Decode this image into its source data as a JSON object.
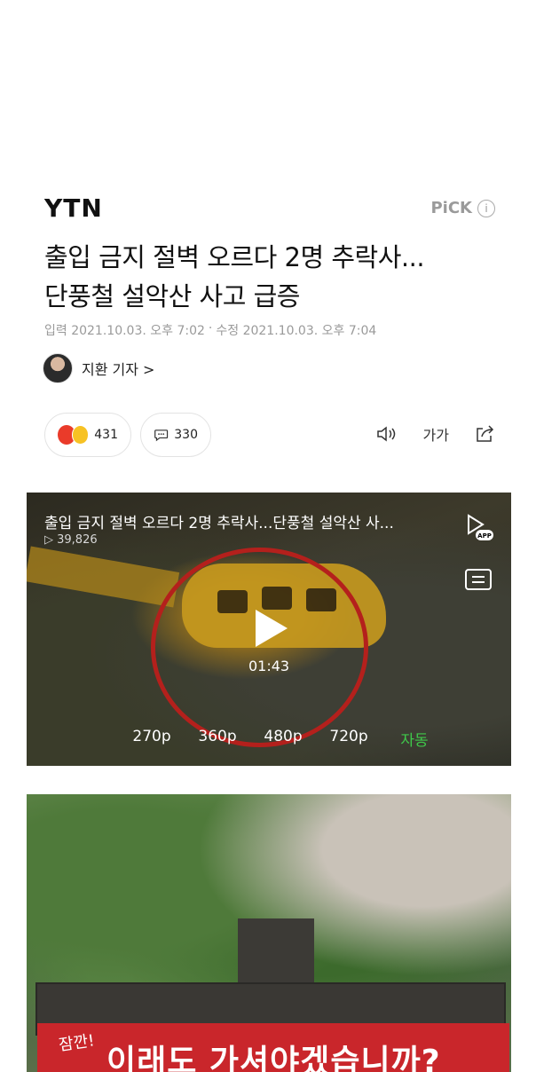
{
  "header": {
    "logo": "YTN",
    "pick_label": "PiCK",
    "info_glyph": "i"
  },
  "article": {
    "headline_line1": "출입 금지 절벽 오르다 2명 추락사...",
    "headline_line2": "단풍철 설악산 사고 급증",
    "published": "입력 2021.10.03. 오후 7:02",
    "separator": "·",
    "modified": "수정 2021.10.03. 오후 7:04",
    "reporter": "지환 기자 >"
  },
  "actions": {
    "reaction_count": "431",
    "comment_count": "330",
    "font_size_label": "가가"
  },
  "video": {
    "title": "출입 금지 절벽 오르다 2명 추락사...단풍철 설악산 사...",
    "views": "▷ 39,826",
    "duration": "01:43",
    "app_badge": "APP",
    "resolutions": [
      "270p",
      "360p",
      "480p",
      "720p",
      "자동"
    ],
    "selected_resolution": "자동",
    "accent_color": "#3fc84a"
  },
  "photo": {
    "sign_small": "잠깐!",
    "sign_main": "이래도 가셔야겠습니까?"
  }
}
